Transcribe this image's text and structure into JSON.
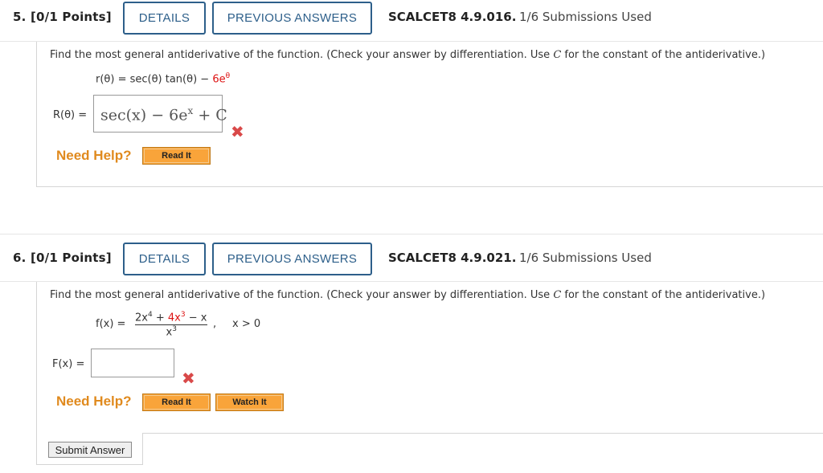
{
  "q5": {
    "number": "5. [0/1 Points]",
    "details_label": "DETAILS",
    "previous_label": "PREVIOUS ANSWERS",
    "reference": "SCALCET8 4.9.016.",
    "submissions": "1/6 Submissions Used",
    "prompt_a": "Find the most general antiderivative of the function. (Check your answer by differentiation. Use ",
    "prompt_c": "C",
    "prompt_b": " for the constant of the antiderivative.)",
    "function_lhs": "r(θ) = sec(θ) tan(θ) − ",
    "function_red": "6e",
    "function_exp": "θ",
    "answer_label": "R(θ) =",
    "answer_value": "sec(x) − 6e",
    "answer_exp": "x",
    "answer_tail": " + C",
    "help_label": "Need Help?",
    "read_it": "Read It"
  },
  "q6": {
    "number": "6. [0/1 Points]",
    "details_label": "DETAILS",
    "previous_label": "PREVIOUS ANSWERS",
    "reference": "SCALCET8 4.9.021.",
    "submissions": "1/6 Submissions Used",
    "prompt_a": "Find the most general antiderivative of the function. (Check your answer by differentiation. Use ",
    "prompt_c": "C",
    "prompt_b": " for the constant of the antiderivative.)",
    "function_lhs": "f(x) =",
    "numerator_a": "2x",
    "numerator_a_exp": "4",
    "numerator_plus": " + ",
    "numerator_b": "4x",
    "numerator_b_exp": "3",
    "numerator_c": " − x",
    "denominator": "x",
    "denominator_exp": "3",
    "condition": "x > 0",
    "answer_label": "F(x) =",
    "answer_value": "",
    "help_label": "Need Help?",
    "read_it": "Read It",
    "watch_it": "Watch It",
    "submit_label": "Submit Answer"
  },
  "colors": {
    "tab_border": "#2d5f8a",
    "error": "#d94949",
    "help": "#e08a1e",
    "help_button": "#f9a43a",
    "highlight": "#d11111"
  },
  "icons": {
    "wrong": "close-icon"
  }
}
